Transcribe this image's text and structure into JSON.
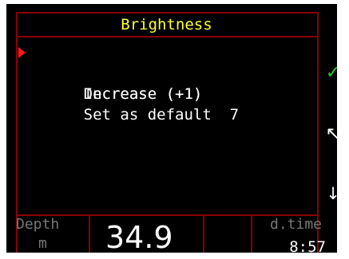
{
  "screen": {
    "title": "Brightness",
    "accent_color": "#ffff33",
    "frame_color": "#8b0000",
    "cursor_color": "#ff1a1a"
  },
  "menu": {
    "items": [
      {
        "label": "Increase (+1)",
        "selected": true
      },
      {
        "label": "Decrease (-1)",
        "selected": false
      },
      {
        "label": "Set as default  7",
        "selected": false
      }
    ]
  },
  "side_buttons": {
    "top_icon": "check-icon",
    "middle_icon": "nw-arrow-icon",
    "bottom_icon": "down-arrow-icon",
    "top_glyph": "✓",
    "middle_glyph": "↖",
    "bottom_glyph": "↓"
  },
  "footer": {
    "depth_label": "Depth",
    "depth_unit": "m",
    "depth_value": "34.9",
    "dtime_label": "d.time",
    "dtime_value": "8:57"
  }
}
